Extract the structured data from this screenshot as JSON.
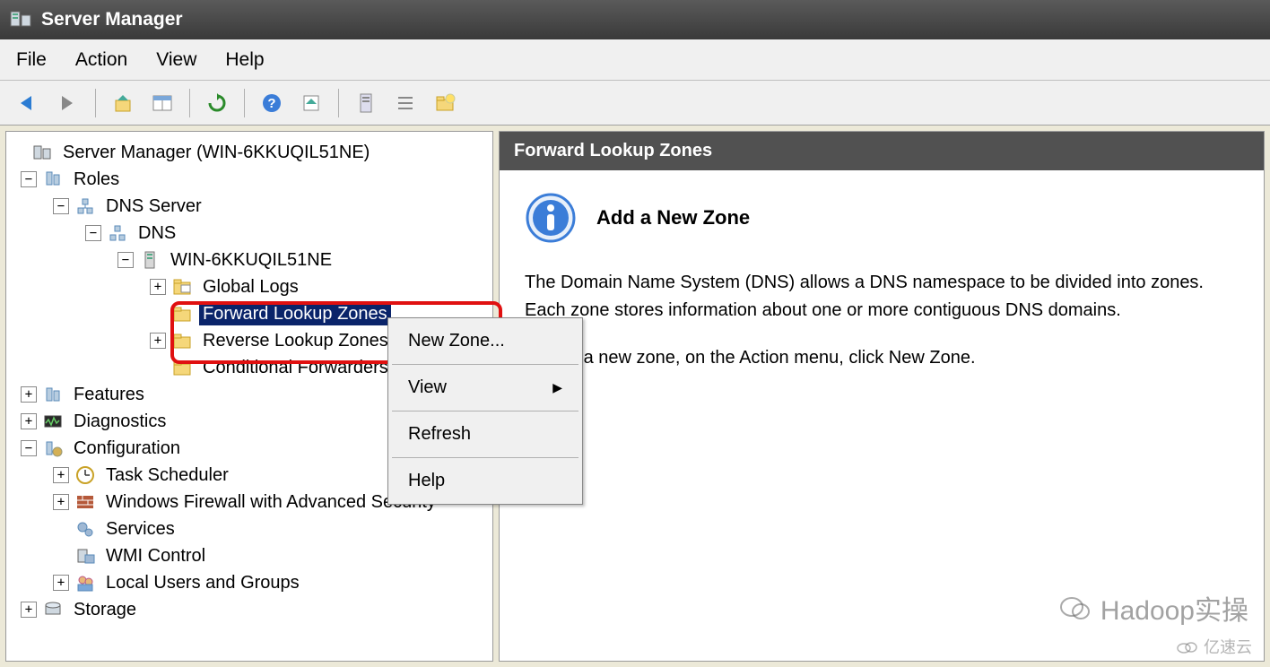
{
  "window": {
    "title": "Server Manager"
  },
  "menubar": {
    "file": "File",
    "action": "Action",
    "view": "View",
    "help": "Help"
  },
  "tree": {
    "root": "Server Manager (WIN-6KKUQIL51NE)",
    "roles": "Roles",
    "dns_server": "DNS Server",
    "dns": "DNS",
    "host": "WIN-6KKUQIL51NE",
    "global_logs": "Global Logs",
    "fwd_zones": "Forward Lookup Zones",
    "rev_zones": "Reverse Lookup Zones",
    "cond_fwd": "Conditional Forwarders",
    "features": "Features",
    "diagnostics": "Diagnostics",
    "configuration": "Configuration",
    "task_scheduler": "Task Scheduler",
    "firewall": "Windows Firewall with Advanced Security",
    "services": "Services",
    "wmi": "WMI Control",
    "local_users": "Local Users and Groups",
    "storage": "Storage"
  },
  "content": {
    "header": "Forward Lookup Zones",
    "info_title": "Add a New Zone",
    "para1": "The Domain Name System (DNS) allows a DNS namespace to be divided into zones. Each zone stores information about one or more contiguous DNS domains.",
    "para2": "To add a new zone, on the Action menu, click New Zone."
  },
  "context_menu": {
    "new_zone": "New Zone...",
    "view": "View",
    "refresh": "Refresh",
    "help": "Help"
  },
  "watermark": {
    "text1": "Hadoop实操",
    "text2": "亿速云"
  }
}
